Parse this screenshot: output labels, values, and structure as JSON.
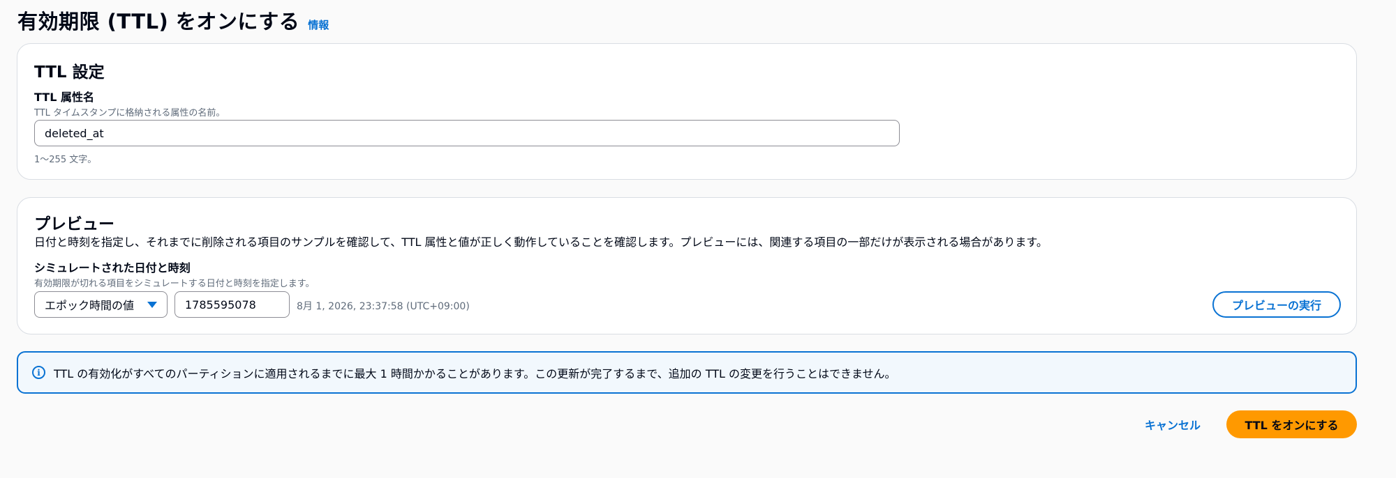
{
  "header": {
    "title": "有効期限 (TTL) をオンにする",
    "info_link": "情報"
  },
  "ttl_settings": {
    "heading": "TTL 設定",
    "field_label": "TTL 属性名",
    "field_description": "TTL タイムスタンプに格納される属性の名前。",
    "field_value": "deleted_at",
    "field_constraint": "1〜255 文字。"
  },
  "preview": {
    "heading": "プレビュー",
    "description": "日付と時刻を指定し、それまでに削除される項目のサンプルを確認して、TTL 属性と値が正しく動作していることを確認します。プレビューには、関連する項目の一部だけが表示される場合があります。",
    "sim_label": "シミュレートされた日付と時刻",
    "sim_description": "有効期限が切れる項目をシミュレートする日付と時刻を指定します。",
    "select_value": "エポック時間の値",
    "epoch_value": "1785595078",
    "date_readout": "8月 1, 2026, 23:37:58 (UTC+09:00)",
    "run_button": "プレビューの実行"
  },
  "alert": {
    "icon": "info-icon",
    "text": "TTL の有効化がすべてのパーティションに適用されるまでに最大 1 時間かかることがあります。この更新が完了するまで、追加の TTL の変更を行うことはできません。"
  },
  "footer": {
    "cancel": "キャンセル",
    "submit": "TTL をオンにする"
  },
  "colors": {
    "accent": "#0972d3",
    "primary_button": "#ff9900",
    "alert_background": "#f2f8fd"
  }
}
